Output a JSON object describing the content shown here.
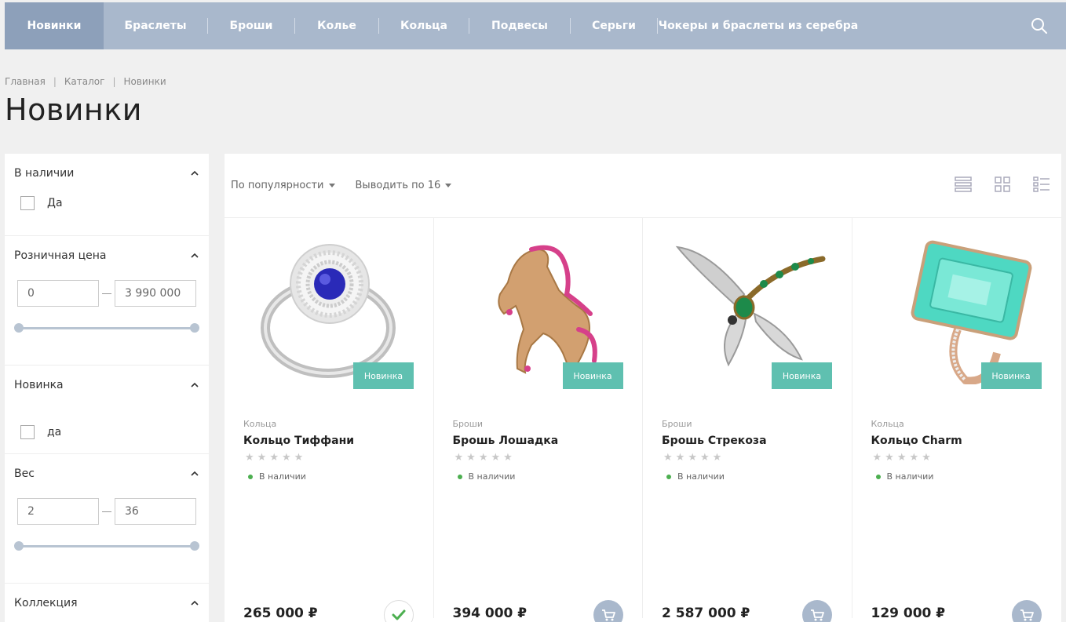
{
  "nav": {
    "items": [
      {
        "label": "Новинки",
        "active": true
      },
      {
        "label": "Браслеты"
      },
      {
        "label": "Броши"
      },
      {
        "label": "Колье"
      },
      {
        "label": "Кольца"
      },
      {
        "label": "Подвесы"
      },
      {
        "label": "Серьги"
      },
      {
        "label": "Чокеры и браслеты из серебра"
      }
    ],
    "search_icon": "search-icon"
  },
  "breadcrumb": [
    "Главная",
    "Каталог",
    "Новинки"
  ],
  "breadcrumb_sep": "|",
  "page_title": "Новинки",
  "filters": {
    "stock": {
      "title": "В наличии",
      "option": "Да"
    },
    "price": {
      "title": "Розничная цена",
      "min": "0",
      "max": "3 990 000"
    },
    "novelty": {
      "title": "Новинка",
      "option": "да"
    },
    "weight": {
      "title": "Вес",
      "min": "2",
      "max": "36"
    },
    "collection": {
      "title": "Коллекция"
    }
  },
  "toolbar": {
    "sort_label": "По популярности",
    "per_page_label": "Выводить по 16",
    "view_icons": [
      "list-view-icon",
      "grid-view-icon",
      "table-view-icon"
    ]
  },
  "products": [
    {
      "category": "Кольца",
      "title": "Кольцо Тиффани",
      "badge": "Новинка",
      "stock": "В наличии",
      "price": "265 000 ₽",
      "in_cart": true
    },
    {
      "category": "Броши",
      "title": "Брошь Лошадка",
      "badge": "Новинка",
      "stock": "В наличии",
      "price": "394 000 ₽",
      "in_cart": false
    },
    {
      "category": "Броши",
      "title": "Брошь Стрекоза",
      "badge": "Новинка",
      "stock": "В наличии",
      "price": "2 587 000 ₽",
      "in_cart": false
    },
    {
      "category": "Кольца",
      "title": "Кольцо Charm",
      "badge": "Новинка",
      "stock": "В наличии",
      "price": "129 000 ₽",
      "in_cart": false
    }
  ],
  "colors": {
    "nav_bg": "#a9b8cc",
    "nav_active": "#8da0ba",
    "badge": "#5fc0b0",
    "stock_dot": "#4caf50"
  }
}
